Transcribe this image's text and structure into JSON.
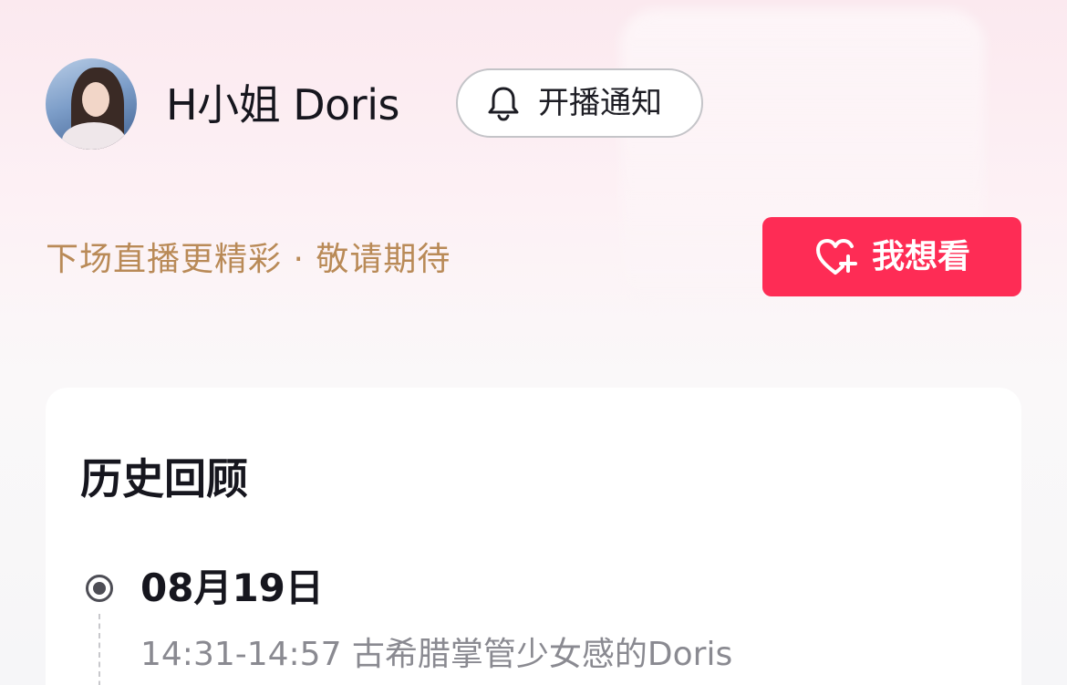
{
  "header": {
    "streamer_name": "H小姐 Doris",
    "avatar_icon": "avatar-icon",
    "notify_button": {
      "label": "开播通知",
      "icon": "bell-icon"
    }
  },
  "promo": {
    "subtitle": "下场直播更精彩 · 敬请期待",
    "want_button": {
      "label": "我想看",
      "icon": "heart-plus-icon",
      "color": "#fe2c55"
    }
  },
  "history": {
    "title": "历史回顾",
    "entries": [
      {
        "date": "08月19日",
        "time_title": "14:31-14:57 古希腊掌管少女感的Doris"
      }
    ]
  },
  "colors": {
    "accent": "#fe2c55",
    "subtitle_text": "#b98a57",
    "primary_text": "#16161e",
    "secondary_text": "#8a8a91"
  }
}
